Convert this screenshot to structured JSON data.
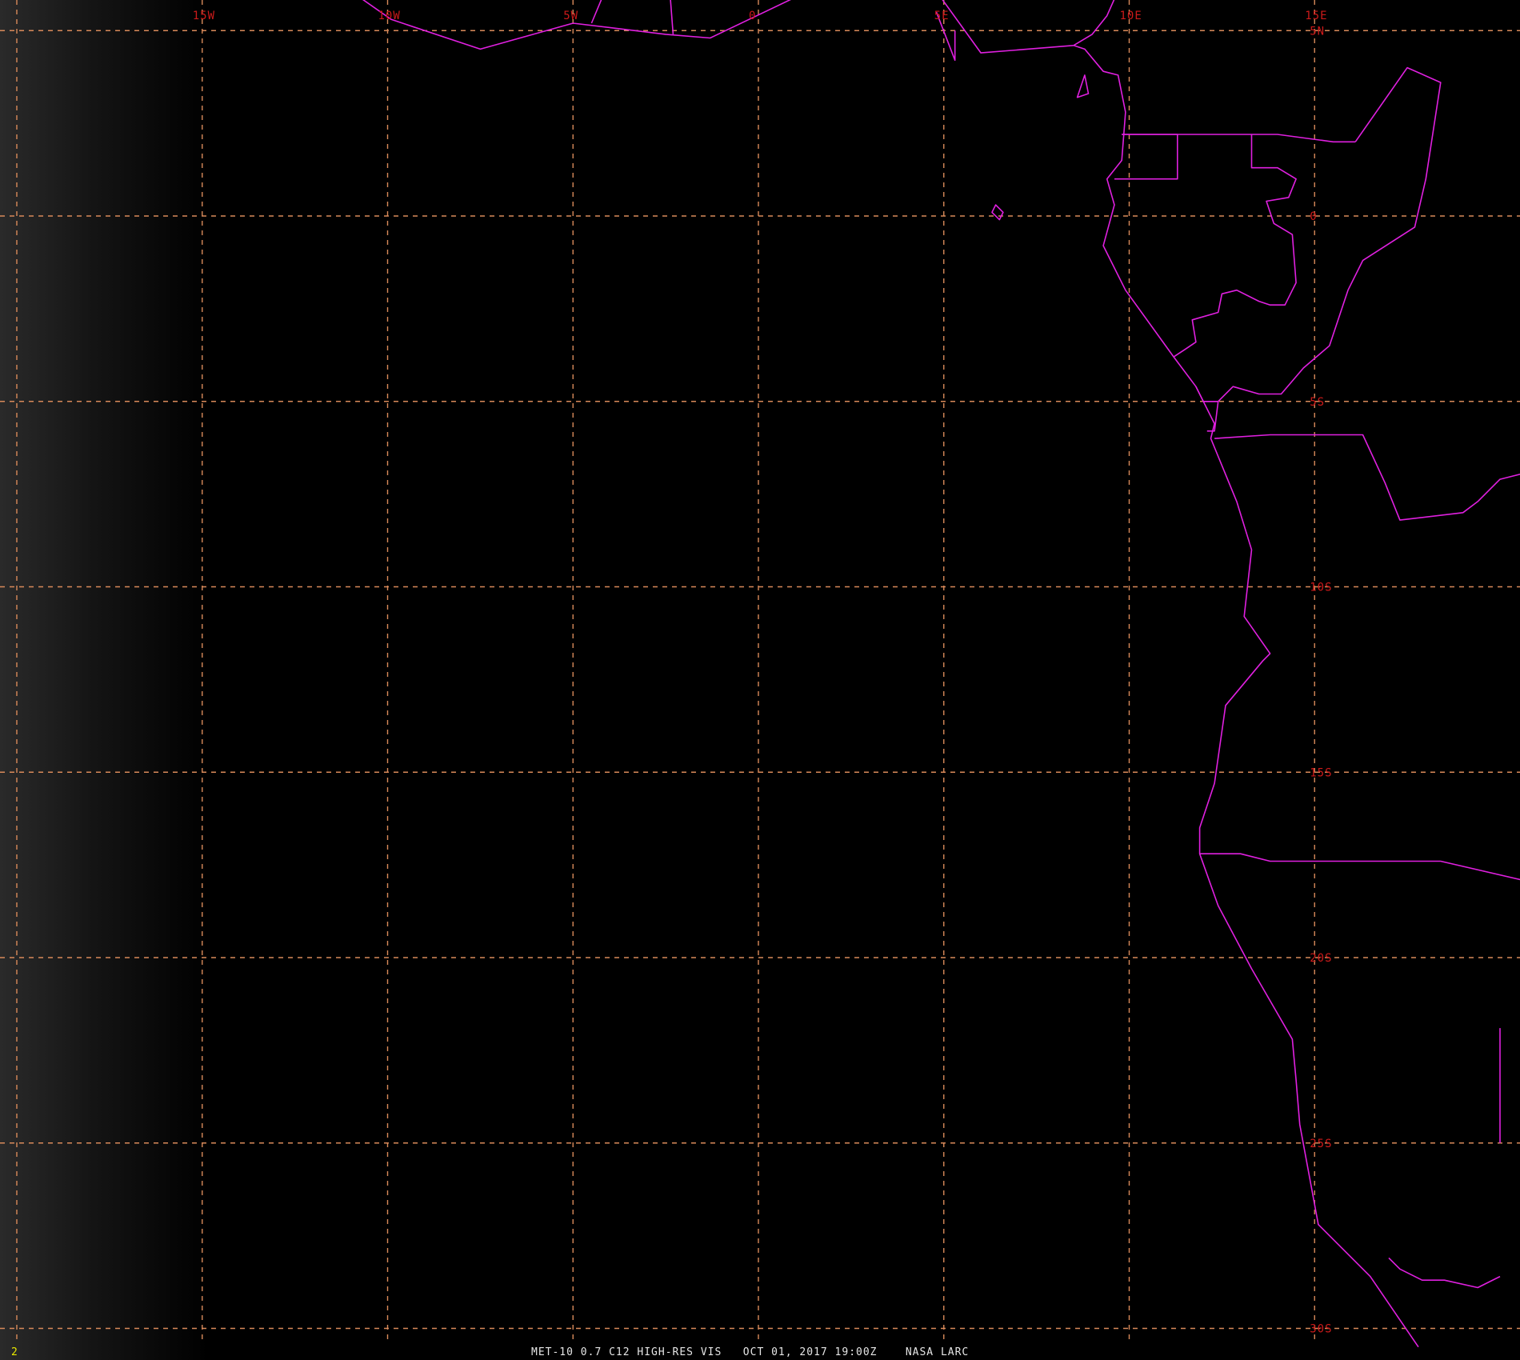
{
  "image": {
    "caption": "MET-10 0.7 C12 HIGH-RES VIS   OCT 01, 2017 19:00Z    NASA LARC",
    "frame_number": "2"
  },
  "colors": {
    "background": "#000000",
    "grid_line": "#d98a5a",
    "grid_label": "#cc1a1a",
    "boundary": "#e020e0",
    "frame_number": "#e8e800",
    "caption": "#e6e6e6"
  },
  "graticule": {
    "longitudes": [
      {
        "value": -20,
        "label": ""
      },
      {
        "value": -15,
        "label": "15W"
      },
      {
        "value": -10,
        "label": "10W"
      },
      {
        "value": -5,
        "label": "5W"
      },
      {
        "value": 0,
        "label": "0"
      },
      {
        "value": 5,
        "label": "5E"
      },
      {
        "value": 10,
        "label": "10E"
      },
      {
        "value": 15,
        "label": "15E"
      }
    ],
    "latitudes": [
      {
        "value": 5,
        "label": "5N"
      },
      {
        "value": 0,
        "label": "0"
      },
      {
        "value": -5,
        "label": "5S"
      },
      {
        "value": -10,
        "label": "10S"
      },
      {
        "value": -15,
        "label": "15S"
      },
      {
        "value": -20,
        "label": "20S"
      },
      {
        "value": -25,
        "label": "25S"
      },
      {
        "value": -30,
        "label": "30S"
      }
    ]
  },
  "boundaries": {
    "west_africa_coast": [
      [
        -11.9,
        6.7
      ],
      [
        -9.9,
        5.3
      ],
      [
        -7.5,
        4.5
      ],
      [
        -5.0,
        5.2
      ],
      [
        -2.5,
        4.9
      ],
      [
        -1.3,
        4.8
      ],
      [
        1.0,
        5.9
      ],
      [
        4.7,
        6.2
      ],
      [
        6.0,
        4.4
      ],
      [
        8.5,
        4.6
      ],
      [
        8.8,
        4.5
      ],
      [
        9.3,
        3.9
      ],
      [
        9.7,
        3.8
      ],
      [
        9.9,
        2.8
      ],
      [
        9.8,
        1.5
      ],
      [
        9.4,
        1.0
      ],
      [
        9.6,
        0.3
      ],
      [
        9.3,
        -0.8
      ],
      [
        9.9,
        -2.0
      ],
      [
        11.2,
        -3.8
      ],
      [
        11.8,
        -4.6
      ],
      [
        12.3,
        -5.6
      ],
      [
        12.2,
        -6.0
      ],
      [
        12.9,
        -7.7
      ],
      [
        13.3,
        -9.0
      ],
      [
        13.1,
        -10.8
      ],
      [
        13.8,
        -11.8
      ],
      [
        13.6,
        -12.0
      ],
      [
        12.6,
        -13.2
      ],
      [
        12.3,
        -15.3
      ],
      [
        11.9,
        -16.5
      ],
      [
        11.9,
        -17.2
      ],
      [
        12.4,
        -18.6
      ],
      [
        13.3,
        -20.3
      ],
      [
        14.4,
        -22.2
      ],
      [
        14.5,
        -23.3
      ],
      [
        14.6,
        -24.5
      ],
      [
        15.1,
        -27.2
      ],
      [
        16.5,
        -28.6
      ],
      [
        17.8,
        -30.5
      ]
    ],
    "north_borders": [
      [
        [
          -4.5,
          5.2
        ],
        [
          -4.0,
          6.4
        ],
        [
          -3.0,
          6.6
        ]
      ],
      [
        [
          -2.3,
          4.9
        ],
        [
          -2.4,
          6.2
        ]
      ],
      [
        [
          1.6,
          6.2
        ],
        [
          1.7,
          6.5
        ]
      ],
      [
        [
          5.3,
          5.0
        ],
        [
          5.3,
          4.2
        ],
        [
          4.8,
          5.5
        ]
      ],
      [
        [
          8.5,
          4.6
        ],
        [
          9.0,
          4.9
        ],
        [
          9.4,
          5.4
        ],
        [
          9.8,
          6.3
        ]
      ]
    ],
    "gabon_eq_guinea": [
      [
        9.8,
        2.2
      ],
      [
        11.3,
        2.2
      ],
      [
        11.3,
        1.0
      ],
      [
        9.6,
        1.0
      ]
    ],
    "cameroon_border": [
      [
        9.8,
        2.2
      ],
      [
        11.3,
        2.2
      ],
      [
        13.3,
        2.2
      ],
      [
        14.0,
        2.2
      ],
      [
        15.5,
        2.0
      ],
      [
        16.1,
        2.0
      ]
    ],
    "gabon_congo": [
      [
        13.3,
        2.2
      ],
      [
        13.3,
        1.3
      ],
      [
        14.0,
        1.3
      ],
      [
        14.5,
        1.0
      ],
      [
        14.3,
        0.5
      ],
      [
        13.7,
        0.4
      ],
      [
        13.9,
        -0.2
      ],
      [
        14.4,
        -0.5
      ],
      [
        14.5,
        -1.8
      ],
      [
        14.4,
        -2.0
      ],
      [
        14.2,
        -2.4
      ],
      [
        13.8,
        -2.4
      ],
      [
        13.5,
        -2.3
      ],
      [
        12.9,
        -2.0
      ],
      [
        12.5,
        -2.1
      ],
      [
        12.4,
        -2.6
      ],
      [
        11.7,
        -2.8
      ],
      [
        11.8,
        -3.4
      ],
      [
        11.5,
        -3.6
      ],
      [
        11.2,
        -3.8
      ]
    ],
    "congo_drc": [
      [
        16.1,
        2.0
      ],
      [
        17.5,
        4.0
      ],
      [
        18.4,
        3.6
      ],
      [
        18.0,
        1.0
      ],
      [
        17.7,
        -0.3
      ],
      [
        16.3,
        -1.2
      ],
      [
        15.9,
        -2.0
      ],
      [
        15.4,
        -3.5
      ],
      [
        14.7,
        -4.1
      ],
      [
        14.1,
        -4.8
      ],
      [
        13.5,
        -4.8
      ],
      [
        12.8,
        -4.6
      ],
      [
        12.4,
        -5.0
      ],
      [
        12.0,
        -5.0
      ],
      [
        11.8,
        -4.6
      ]
    ],
    "cabinda": [
      [
        12.0,
        -5.0
      ],
      [
        12.2,
        -5.0
      ],
      [
        12.4,
        -5.0
      ],
      [
        12.3,
        -5.8
      ],
      [
        12.1,
        -5.8
      ]
    ],
    "angola_north": [
      [
        12.3,
        -6.0
      ],
      [
        13.8,
        -5.9
      ],
      [
        16.3,
        -5.9
      ],
      [
        16.9,
        -7.2
      ],
      [
        17.3,
        -8.2
      ],
      [
        19.0,
        -8.0
      ],
      [
        19.4,
        -7.7
      ],
      [
        20.0,
        -7.1
      ],
      [
        20.8,
        -6.9
      ]
    ],
    "angola_namibia": [
      [
        11.9,
        -17.2
      ],
      [
        13.0,
        -17.2
      ],
      [
        13.8,
        -17.4
      ],
      [
        14.2,
        -17.4
      ],
      [
        18.4,
        -17.4
      ],
      [
        21.0,
        -18.0
      ]
    ],
    "namibia_east": [
      [
        20.0,
        -21.9
      ],
      [
        20.0,
        -24.8
      ],
      [
        20.0,
        -25.0
      ]
    ],
    "namibia_south": [
      [
        17.0,
        -28.1
      ],
      [
        17.3,
        -28.4
      ],
      [
        17.9,
        -28.7
      ],
      [
        18.5,
        -28.7
      ],
      [
        19.4,
        -28.9
      ],
      [
        20.0,
        -28.6
      ]
    ],
    "annobon_island": [
      [
        6.4,
        0.3
      ],
      [
        6.6,
        0.1
      ],
      [
        6.5,
        -0.1
      ],
      [
        6.3,
        0.1
      ]
    ],
    "bioko_island": [
      [
        8.6,
        3.2
      ],
      [
        8.8,
        3.8
      ],
      [
        8.9,
        3.3
      ]
    ]
  }
}
